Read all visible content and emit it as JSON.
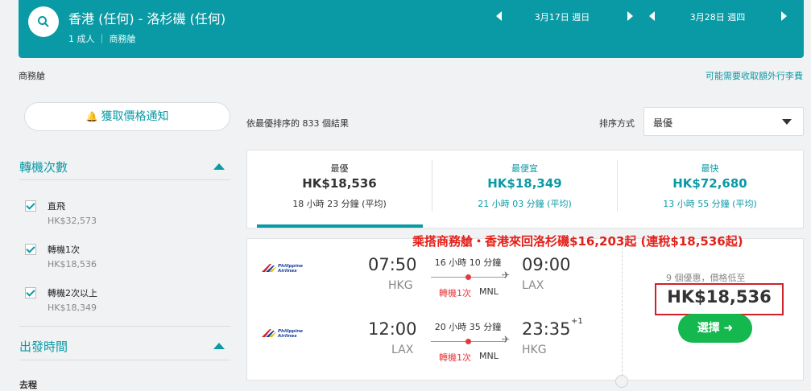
{
  "header": {
    "route": "香港 (任何) - 洛杉磯 (任何)",
    "pax": "1 成人 ｜ 商務艙",
    "depart_date": "3月17日 週日",
    "return_date": "3月28日 週四",
    "bg_color": "#0a9aa5"
  },
  "cabin_label": "商務艙",
  "fees_link": "可能需要收取額外行李費",
  "alert_button": "獲取價格通知",
  "filters": {
    "stops_title": "轉機次數",
    "stops": [
      {
        "label": "直飛",
        "price": "HK$32,573"
      },
      {
        "label": "轉機1次",
        "price": "HK$18,536"
      },
      {
        "label": "轉機2次以上",
        "price": "HK$18,349"
      }
    ],
    "departure_title": "出發時間",
    "departure_sub": "去程"
  },
  "results": {
    "count_text": "依最優排序的 833 個結果",
    "sort_label": "排序方式",
    "sort_value": "最優"
  },
  "tabs": [
    {
      "name": "最優",
      "price": "HK$18,536",
      "duration": "18 小時 23 分鐘 (平均)"
    },
    {
      "name": "最便宜",
      "price": "HK$18,349",
      "duration": "21 小時 03 分鐘 (平均)"
    },
    {
      "name": "最快",
      "price": "HK$72,680",
      "duration": "13 小時 55 分鐘 (平均)"
    }
  ],
  "promo_text": "乘搭商務艙・香港來回洛杉磯$16,203起 (連稅$18,536起)",
  "card": {
    "airline": "Philippine Airlines",
    "outbound": {
      "dep_time": "07:50",
      "dep_code": "HKG",
      "duration": "16 小時 10 分鐘",
      "stops": "轉機1次",
      "via": "MNL",
      "arr_time": "09:00",
      "arr_code": "LAX"
    },
    "inbound": {
      "dep_time": "12:00",
      "dep_code": "LAX",
      "duration": "20 小時 35 分鐘",
      "stops": "轉機1次",
      "via": "MNL",
      "arr_time": "23:35",
      "arr_plus": "+1",
      "arr_code": "HKG"
    },
    "offers": "9 個優惠，價格低至",
    "price": "HK$18,536",
    "select_button": "選擇 ➜"
  },
  "colors": {
    "accent": "#0a9aa5",
    "promo": "#e4201a",
    "select": "#14b84e",
    "stop_dot": "#e4393c"
  }
}
